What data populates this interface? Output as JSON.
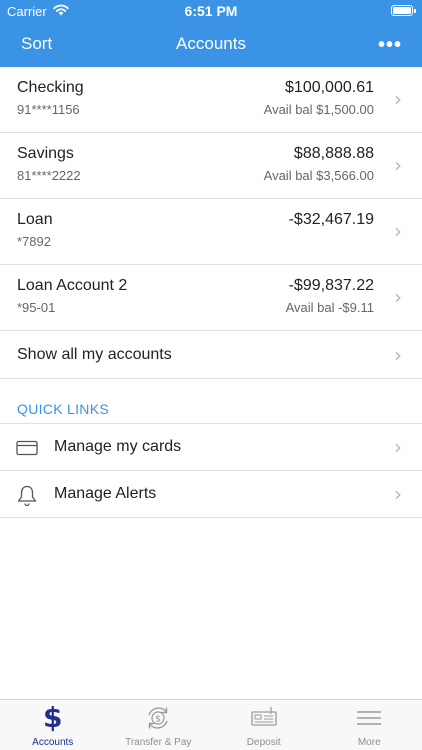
{
  "status": {
    "carrier": "Carrier",
    "time": "6:51 PM"
  },
  "nav": {
    "left": "Sort",
    "title": "Accounts",
    "more": "•••"
  },
  "accounts": [
    {
      "name": "Checking",
      "number": "91****1156",
      "balance": "$100,000.61",
      "avail": "Avail bal $1,500.00"
    },
    {
      "name": "Savings",
      "number": "81****2222",
      "balance": "$88,888.88",
      "avail": "Avail bal $3,566.00"
    },
    {
      "name": "Loan",
      "number": "*7892",
      "balance": "-$32,467.19",
      "avail": ""
    },
    {
      "name": "Loan Account 2",
      "number": "*95-01",
      "balance": "-$99,837.22",
      "avail": "Avail bal -$9.11"
    }
  ],
  "show_all": "Show all my accounts",
  "quick_links": {
    "title": "QUICK LINKS",
    "items": [
      {
        "label": "Manage my cards",
        "icon": "credit-card-icon"
      },
      {
        "label": "Manage Alerts",
        "icon": "bell-icon"
      }
    ]
  },
  "tabs": [
    {
      "label": "Accounts",
      "icon": "dollar-icon",
      "active": true
    },
    {
      "label": "Transfer & Pay",
      "icon": "transfer-icon",
      "active": false
    },
    {
      "label": "Deposit",
      "icon": "check-deposit-icon",
      "active": false
    },
    {
      "label": "More",
      "icon": "menu-icon",
      "active": false
    }
  ],
  "colors": {
    "header": "#3a93e4",
    "active_tab": "#1f2f8c",
    "quick_links": "#3a93e4"
  }
}
